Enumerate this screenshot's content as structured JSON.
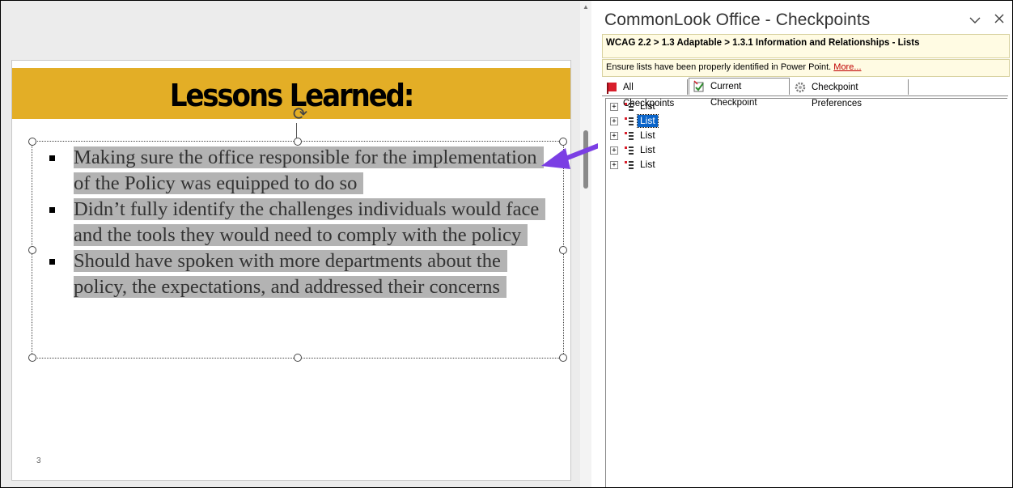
{
  "slide": {
    "title": "Lessons Learned:",
    "bullets": [
      "Making sure the office responsible for the implementation of the Policy was equipped to do so",
      "Didn’t fully identify the challenges individuals would face and the tools they would need to comply with the policy",
      "Should have spoken with more departments about the policy, the expectations, and addressed their concerns"
    ],
    "number": "3"
  },
  "pane": {
    "title": "CommonLook Office - Checkpoints",
    "breadcrumb": "WCAG 2.2 > 1.3 Adaptable > 1.3.1 Information and Relationships - Lists",
    "description": "Ensure lists have been properly identified in Power Point.",
    "more_link": "More...",
    "tabs": [
      {
        "label": "All Checkpoints"
      },
      {
        "label": "Current Checkpoint"
      },
      {
        "label": "Checkpoint Preferences"
      }
    ],
    "tree": [
      {
        "label": "List",
        "selected": false
      },
      {
        "label": "List",
        "selected": true
      },
      {
        "label": "List",
        "selected": false
      },
      {
        "label": "List",
        "selected": false
      },
      {
        "label": "List",
        "selected": false
      }
    ]
  },
  "colors": {
    "title_band": "#e3ae26",
    "selection_highlight": "#b3b3b3",
    "arrow": "#7b3fe4",
    "tree_selected": "#0a64c9"
  }
}
